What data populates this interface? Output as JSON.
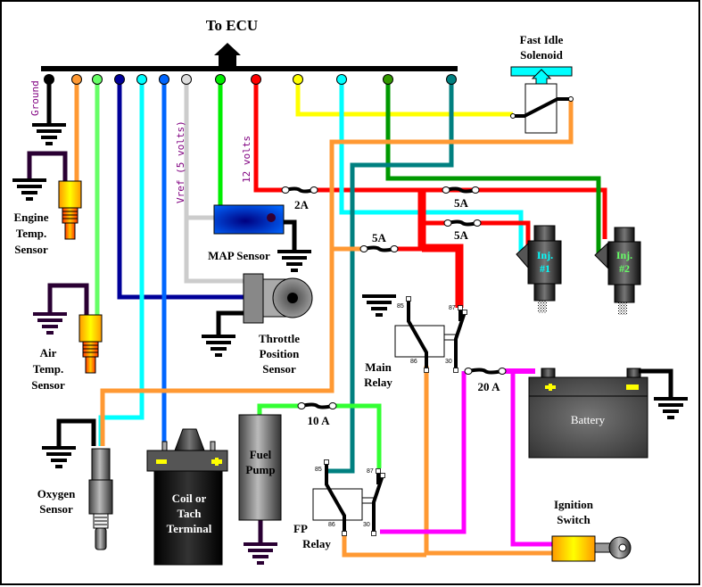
{
  "title": "To ECU",
  "ecu_pins": [
    {
      "color": "#000000",
      "name": "ground"
    },
    {
      "color": "#ff9933",
      "name": "orange"
    },
    {
      "color": "#66ff66",
      "name": "light-green"
    },
    {
      "color": "#000099",
      "name": "dark-blue"
    },
    {
      "color": "#00ffff",
      "name": "cyan"
    },
    {
      "color": "#0066ff",
      "name": "blue"
    },
    {
      "color": "#dddddd",
      "name": "gray"
    },
    {
      "color": "#00ee00",
      "name": "green"
    },
    {
      "color": "#ff0000",
      "name": "red"
    },
    {
      "color": "#ffff00",
      "name": "yellow"
    },
    {
      "color": "#00ffff",
      "name": "cyan-2"
    },
    {
      "color": "#339900",
      "name": "dark-green"
    },
    {
      "color": "#008080",
      "name": "teal"
    }
  ],
  "wire_labels": {
    "ground": "Ground",
    "vref": "Vref (5 volts)",
    "twelve_volts": "12 volts"
  },
  "components": {
    "fast_idle_solenoid": [
      "Fast Idle",
      "Solenoid"
    ],
    "engine_temp_sensor": [
      "Engine",
      "Temp.",
      "Sensor"
    ],
    "air_temp_sensor": [
      "Air",
      "Temp.",
      "Sensor"
    ],
    "map_sensor": "MAP Sensor",
    "throttle_position_sensor": [
      "Throttle",
      "Position",
      "Sensor"
    ],
    "oxygen_sensor": [
      "Oxygen",
      "Sensor"
    ],
    "coil": [
      "Coil or",
      "Tach",
      "Terminal"
    ],
    "fuel_pump": [
      "Fuel",
      "Pump"
    ],
    "fp_relay": [
      "FP",
      "Relay"
    ],
    "main_relay": [
      "Main",
      "Relay"
    ],
    "battery": "Battery",
    "ignition_switch": [
      "Ignition",
      "Switch"
    ],
    "injector_1": [
      "Inj.",
      "#1"
    ],
    "injector_2": [
      "Inj.",
      "#2"
    ]
  },
  "fuses": {
    "map_fuse": "2A",
    "inj1_fuse": "5A",
    "inj2_fuse": "5A",
    "solenoid_fuse": "5A",
    "main_fuse": "20 A",
    "pump_fuse": "10 A"
  },
  "relay_pins": {
    "p85": "85",
    "p86": "86",
    "p87": "87",
    "p30": "30"
  },
  "colors": {
    "injector1_text": "#00ffff",
    "injector2_text": "#66ff66",
    "label_purple": "#800080",
    "power": "#ff0000",
    "ignition": "#ff00ff"
  }
}
